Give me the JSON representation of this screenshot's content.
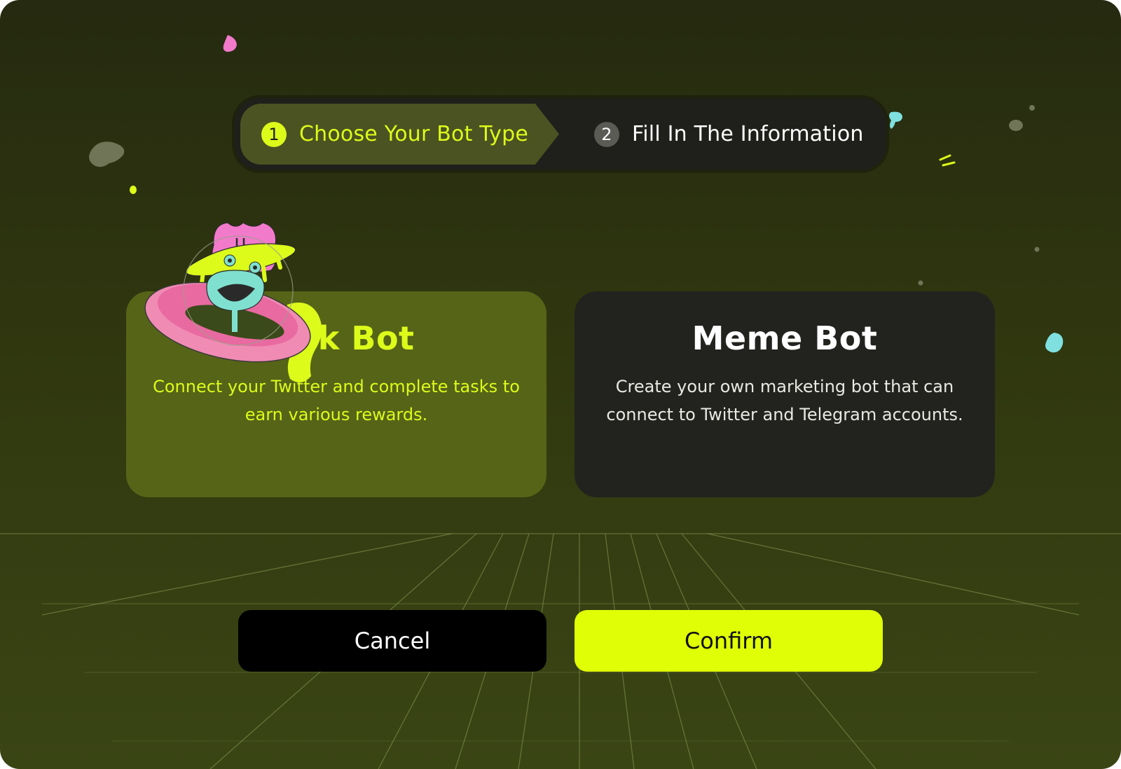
{
  "stepper": {
    "steps": [
      {
        "number": "1",
        "label": "Choose Your Bot Type",
        "active": true
      },
      {
        "number": "2",
        "label": "Fill In The Information",
        "active": false
      }
    ]
  },
  "cards": [
    {
      "id": "task-bot",
      "title": "Task Bot",
      "description": "Connect your Twitter and complete tasks to earn various rewards.",
      "selected": true
    },
    {
      "id": "meme-bot",
      "title": "Meme Bot",
      "description": "Create your own marketing bot that can connect to Twitter and Telegram accounts.",
      "selected": false
    }
  ],
  "actions": {
    "cancel_label": "Cancel",
    "confirm_label": "Confirm"
  },
  "colors": {
    "accent": "#e0ff06",
    "selected_card": "#566418",
    "unselected_card": "#22231f",
    "stepper_bg": "#1f201b"
  },
  "icons": {
    "mascot": "alien-ufo-mascot-illustration"
  }
}
